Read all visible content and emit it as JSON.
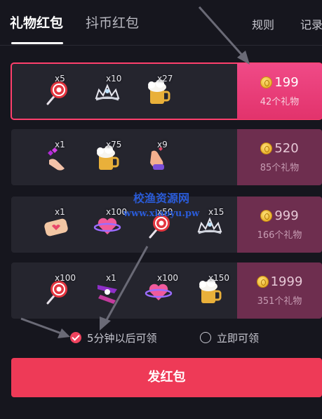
{
  "tabs": {
    "gift": "礼物红包",
    "coin": "抖币红包",
    "rule": "规则",
    "record": "记录"
  },
  "packages": [
    {
      "items": [
        {
          "icon": "lollipop-icon",
          "count": "x5"
        },
        {
          "icon": "tiara-icon",
          "count": "x10"
        },
        {
          "icon": "beer-mug-icon",
          "count": "x27"
        }
      ],
      "price": "199",
      "gift_count": "42个礼物",
      "selected": true
    },
    {
      "items": [
        {
          "icon": "hand-heart-icon",
          "count": "x1"
        },
        {
          "icon": "beer-mug-icon",
          "count": "x75"
        },
        {
          "icon": "finger-heart-icon",
          "count": "x9"
        }
      ],
      "price": "520",
      "gift_count": "85个礼物",
      "selected": false
    },
    {
      "items": [
        {
          "icon": "gift-card-icon",
          "count": "x1"
        },
        {
          "icon": "heart-planet-icon",
          "count": "x100"
        },
        {
          "icon": "lollipop-icon",
          "count": "x50"
        },
        {
          "icon": "tiara-icon",
          "count": "x15"
        }
      ],
      "price": "999",
      "gift_count": "166个礼物",
      "selected": false
    },
    {
      "items": [
        {
          "icon": "lollipop-icon",
          "count": "x100"
        },
        {
          "icon": "ribbon-icon",
          "count": "x1"
        },
        {
          "icon": "heart-planet-icon",
          "count": "x100"
        },
        {
          "icon": "beer-mug-icon",
          "count": "x150"
        }
      ],
      "price": "1999",
      "gift_count": "351个礼物",
      "selected": false
    }
  ],
  "watermark": {
    "line1": "校渔资源网",
    "line2": "www.xiaoyu.pw"
  },
  "options": {
    "later": "5分钟以后可领",
    "now": "立即可领",
    "selected": "later"
  },
  "send_button": "发红包",
  "colors": {
    "accent": "#ee3a57",
    "selected_price": "#e8417a",
    "price_dim": "#6e2e4f",
    "background": "#16161e",
    "watermark": "#2a5bd7",
    "arrow": "#6a6a76"
  }
}
